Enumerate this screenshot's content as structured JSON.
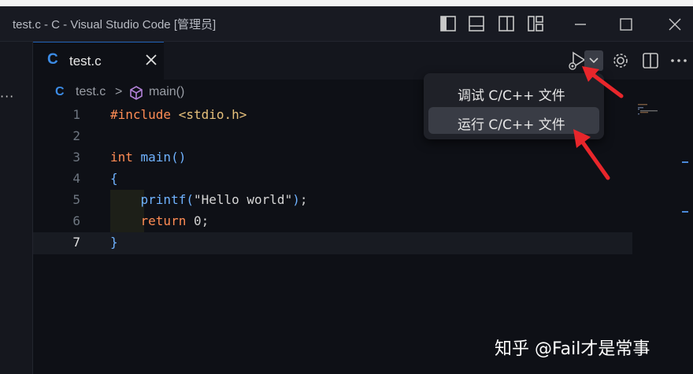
{
  "window": {
    "title": "test.c - C - Visual Studio Code [管理员]"
  },
  "tab": {
    "lang_icon": "C",
    "label": "test.c"
  },
  "breadcrumb": {
    "file_icon": "C",
    "file": "test.c",
    "separator": ">",
    "symbol": "main()"
  },
  "code": {
    "lines": [
      {
        "n": "1",
        "tokens": [
          [
            "prep",
            "#include "
          ],
          [
            "inc",
            "<stdio.h>"
          ]
        ]
      },
      {
        "n": "2",
        "tokens": []
      },
      {
        "n": "3",
        "tokens": [
          [
            "kw",
            "int "
          ],
          [
            "fn",
            "main"
          ],
          [
            "br",
            "()"
          ]
        ]
      },
      {
        "n": "4",
        "tokens": [
          [
            "br",
            "{"
          ]
        ]
      },
      {
        "n": "5",
        "tokens": [
          [
            "plain",
            "    "
          ],
          [
            "fn",
            "printf"
          ],
          [
            "br",
            "("
          ],
          [
            "str",
            "\"Hello world\""
          ],
          [
            "br",
            ")"
          ],
          [
            "plain",
            ";"
          ]
        ]
      },
      {
        "n": "6",
        "tokens": [
          [
            "plain",
            "    "
          ],
          [
            "kw",
            "return "
          ],
          [
            "plain",
            "0;"
          ]
        ]
      },
      {
        "n": "7",
        "tokens": [
          [
            "br",
            "}"
          ]
        ]
      }
    ],
    "active_line": "7"
  },
  "run_menu": {
    "items": [
      {
        "label": "调试 C/C++ 文件",
        "selected": false
      },
      {
        "label": "运行 C/C++ 文件",
        "selected": true
      }
    ]
  },
  "activity": {
    "more": "···"
  },
  "watermark": "知乎 @Fail才是常事",
  "colors": {
    "accent": "#3c8ce6",
    "arrow": "#e8262b",
    "keyword": "#ff8c54",
    "function": "#6fb2ff"
  },
  "icons": [
    "layout-sidebar-left-icon",
    "layout-panel-icon",
    "layout-sidebar-right-icon",
    "customize-layout-icon",
    "minimize-icon",
    "maximize-icon",
    "close-window-icon",
    "run-debug-icon",
    "chevron-down-icon",
    "gear-icon",
    "split-editor-icon",
    "more-actions-icon",
    "symbol-method-icon"
  ]
}
